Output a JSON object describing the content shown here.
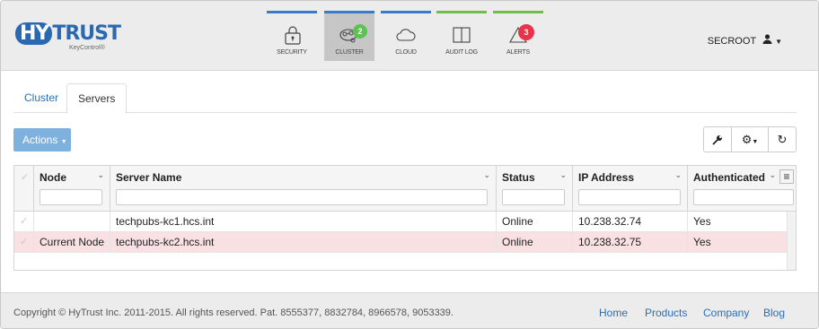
{
  "logo": {
    "hy": "HY",
    "trust": "TRUST",
    "sub": "KeyControl®"
  },
  "nav": [
    {
      "label": "SECURITY",
      "icon": "lock-icon",
      "color": "#3a7bc8"
    },
    {
      "label": "CLUSTER",
      "icon": "cluster-icon",
      "color": "#3a7bc8",
      "badge": "2",
      "badge_color": "#5cc250",
      "active": true
    },
    {
      "label": "CLOUD",
      "icon": "cloud-icon",
      "color": "#3a7bc8"
    },
    {
      "label": "AUDIT LOG",
      "icon": "book-icon",
      "color": "#6cc04a"
    },
    {
      "label": "ALERTS",
      "icon": "warning-icon",
      "color": "#6cc04a",
      "badge": "3",
      "badge_color": "#e8334a"
    }
  ],
  "user": {
    "name": "SECROOT"
  },
  "tabs": [
    {
      "label": "Cluster",
      "active": false
    },
    {
      "label": "Servers",
      "active": true
    }
  ],
  "toolbar": {
    "actions_label": "Actions"
  },
  "grid": {
    "columns": [
      "Node",
      "Server Name",
      "Status",
      "IP Address",
      "Authenticated"
    ],
    "rows": [
      {
        "node": "",
        "server": "techpubs-kc1.hcs.int",
        "status": "Online",
        "ip": "10.238.32.74",
        "auth": "Yes",
        "selected": false
      },
      {
        "node": "Current Node",
        "server": "techpubs-kc2.hcs.int",
        "status": "Online",
        "ip": "10.238.32.75",
        "auth": "Yes",
        "selected": true
      }
    ]
  },
  "footer": {
    "copyright": "Copyright © HyTrust Inc. 2011-2015. All rights reserved. Pat. 8555377, 8832784, 8966578, 9053339.",
    "links": [
      "Home",
      "Products",
      "Company",
      "Blog"
    ]
  },
  "colors": {
    "brand": "#2a68b0",
    "link": "#2a6eb8",
    "actions": "#7fb1de",
    "selected_row": "#f8e0e3"
  }
}
